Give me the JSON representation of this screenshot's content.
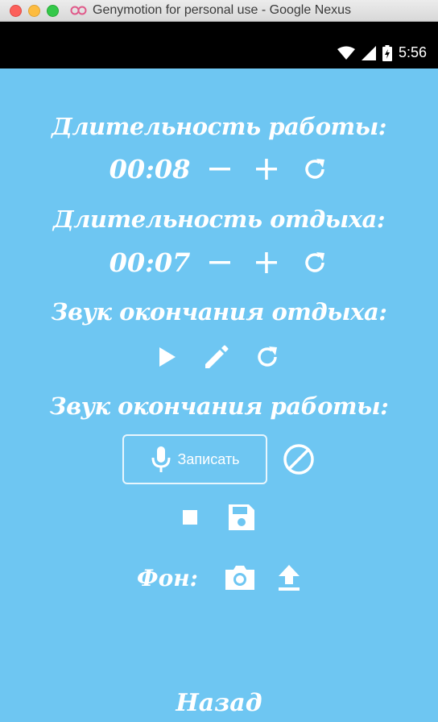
{
  "window": {
    "title": "Genymotion for personal use - Google Nexus"
  },
  "status_bar": {
    "time": "5:56"
  },
  "work": {
    "heading": "Длительность работы:",
    "time": "00:08"
  },
  "rest": {
    "heading": "Длительность отдыха:",
    "time": "00:07"
  },
  "rest_end_sound": {
    "heading": "Звук окончания отдыха:"
  },
  "work_end_sound": {
    "heading": "Звук окончания работы:",
    "record_label": "Записать"
  },
  "background": {
    "label": "Фон:"
  },
  "back": {
    "label": "Назад"
  },
  "colors": {
    "background": "#6ec6f2",
    "foreground": "#ffffff"
  },
  "icons": [
    "minus-icon",
    "plus-icon",
    "refresh-icon",
    "play-icon",
    "pencil-icon",
    "microphone-icon",
    "block-icon",
    "stop-icon",
    "save-icon",
    "camera-icon",
    "upload-icon"
  ]
}
